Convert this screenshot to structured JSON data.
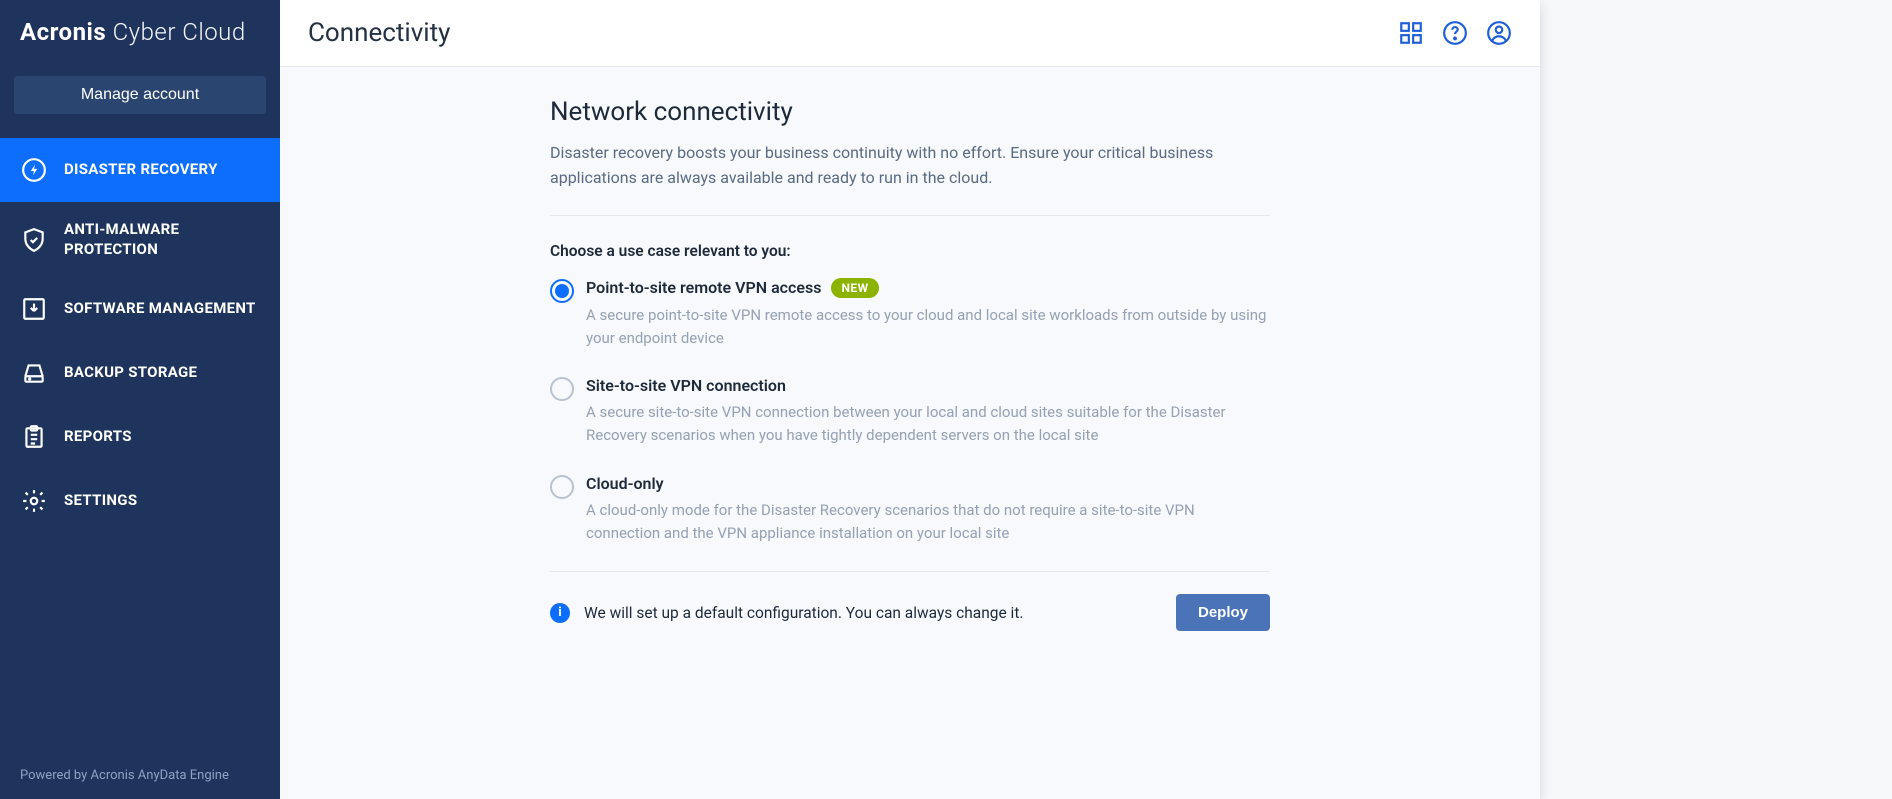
{
  "brand": {
    "bold": "Acronis",
    "light": " Cyber Cloud"
  },
  "sidebar": {
    "manage_label": "Manage account",
    "items": [
      {
        "label": "DISASTER RECOVERY",
        "icon": "bolt",
        "active": true
      },
      {
        "label": "ANTI-MALWARE PROTECTION",
        "icon": "shield",
        "active": false
      },
      {
        "label": "SOFTWARE MANAGEMENT",
        "icon": "download-box",
        "active": false
      },
      {
        "label": "BACKUP STORAGE",
        "icon": "drive",
        "active": false
      },
      {
        "label": "REPORTS",
        "icon": "clipboard",
        "active": false
      },
      {
        "label": "SETTINGS",
        "icon": "gear",
        "active": false
      }
    ],
    "powered": "Powered by Acronis AnyData Engine"
  },
  "header": {
    "title": "Connectivity"
  },
  "main": {
    "heading": "Network connectivity",
    "description": "Disaster recovery boosts your business continuity with no effort. Ensure your critical business applications are always available and ready to run in the cloud.",
    "choose_label": "Choose a use case relevant to you:",
    "options": [
      {
        "title": "Point-to-site remote VPN access",
        "badge": "NEW",
        "selected": true,
        "desc": "A secure point-to-site VPN remote access to your cloud and local site workloads from outside by using your endpoint device"
      },
      {
        "title": "Site-to-site VPN connection",
        "badge": null,
        "selected": false,
        "desc": "A secure site-to-site VPN connection between your local and cloud sites suitable for the Disaster Recovery scenarios when you have tightly dependent servers on the local site"
      },
      {
        "title": "Cloud-only",
        "badge": null,
        "selected": false,
        "desc": "A cloud-only mode for the Disaster Recovery scenarios that do not require a site-to-site VPN connection and the VPN appliance installation on your local site"
      }
    ],
    "footer_note": "We will set up a default configuration. You can always change it.",
    "deploy_label": "Deploy"
  }
}
